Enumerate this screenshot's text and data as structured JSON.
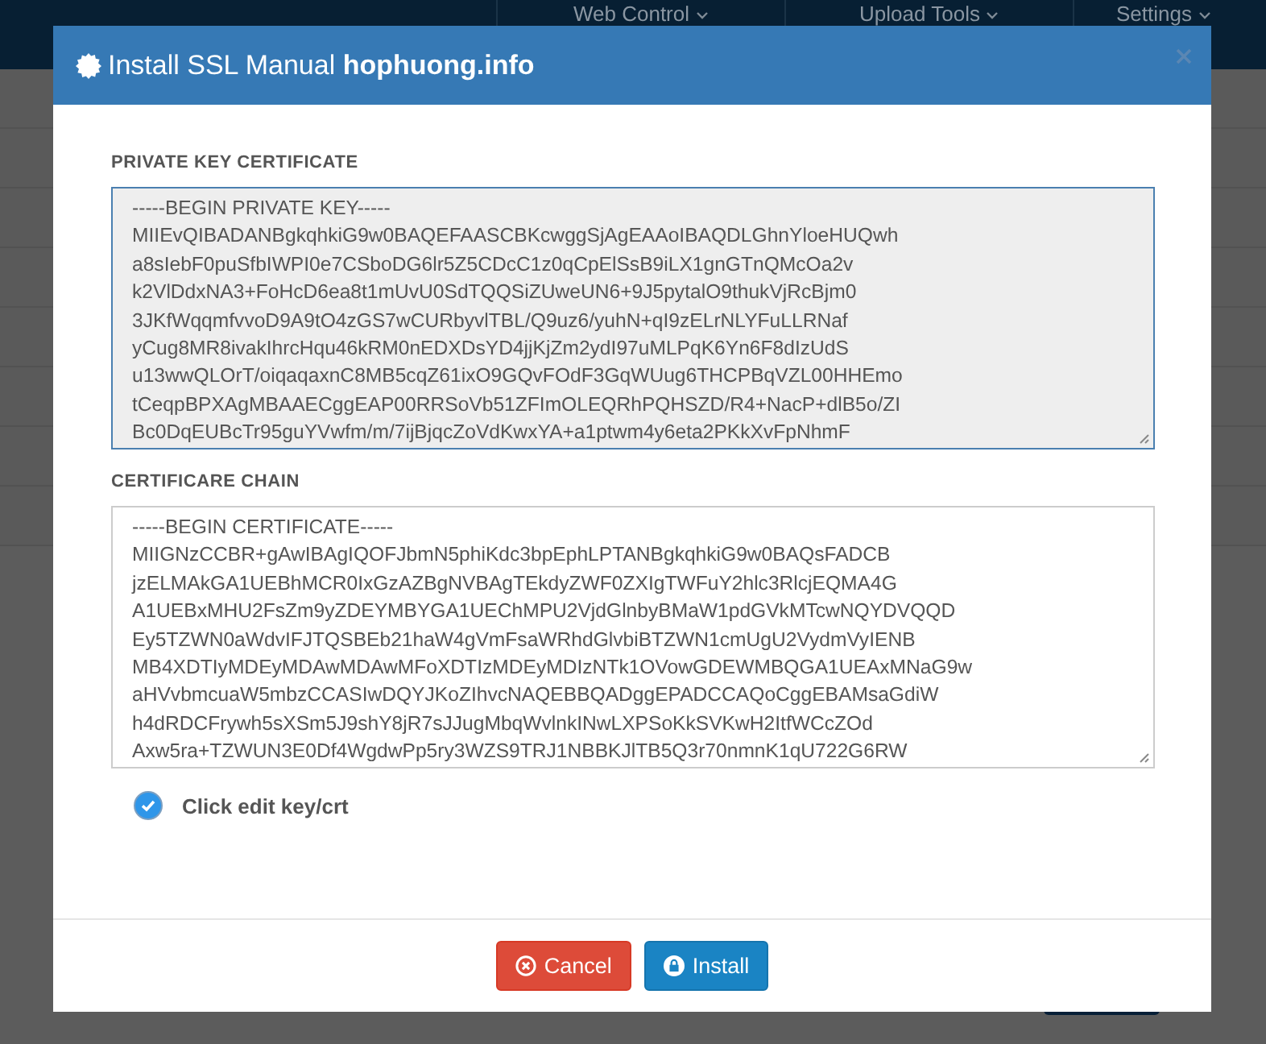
{
  "navbar": {
    "items": [
      {
        "label": "Web Control"
      },
      {
        "label": "Upload Tools"
      },
      {
        "label": "Settings"
      }
    ]
  },
  "modal": {
    "title": "Install SSL Manual **hophuong.info**",
    "private_key": {
      "label": "PRIVATE KEY CERTIFICATE",
      "disabled": true,
      "lines": [
        "-----BEGIN PRIVATE KEY-----",
        "MIIEvQIBADANBgkqhkiG9w0BAQEFAASCBKcwggSjAgEAAoIBAQDLGhnYloeHUQwh",
        "a8sIebF0puSfbIWPI0e7CSboDG6lr5Z5CDcC1z0qCpElSsB9iLX1gnGTnQMcOa2v",
        "k2VlDdxNA3+FoHcD6ea8t1mUvU0SdTQQSiZUweUN6+9J5pytalO9thukVjRcBjm0",
        "3JKfWqqmfvvoD9A9tO4zGS7wCURbyvlTBL/Q9uz6/yuhN+qI9zELrNLYFuLLRNaf",
        "yCug8MR8ivakIhrcHqu46kRM0nEDXDsYD4jjKjZm2ydI97uMLPqK6Yn6F8dIzUdS",
        "u13wwQLOrT/oiqaqaxnC8MB5cqZ61ixO9GQvFOdF3GqWUug6THCPBqVZL00HHEmo",
        "tCeqpBPXAgMBAAECggEAP00RRSoVb51ZFImOLEQRhPQHSZD/R4+NacP+dlB5o/ZI",
        "Bc0DqEUBcTr95guYVwfm/m/7ijBjqcZoVdKwxYA+a1ptwm4y6eta2PKkXvFpNhmF"
      ]
    },
    "certificate_chain": {
      "label": "CERTIFICARE CHAIN",
      "disabled": false,
      "lines": [
        "-----BEGIN CERTIFICATE-----",
        "MIIGNzCCBR+gAwIBAgIQOFJbmN5phiKdc3bpEphLPTANBgkqhkiG9w0BAQsFADCB",
        "jzELMAkGA1UEBhMCR0IxGzAZBgNVBAgTEkdyZWF0ZXIgTWFuY2hlc3RlcjEQMA4G",
        "A1UEBxMHU2FsZm9yZDEYMBYGA1UEChMPU2VjdGlnbyBMaW1pdGVkMTcwNQYDVQQD",
        "Ey5TZWN0aWdvIFJTQSBEb21haW4gVmFsaWRhdGlvbiBTZWN1cmUgU2VydmVyIENB",
        "MB4XDTIyMDEyMDAwMDAwMFoXDTIzMDEyMDIzNTk1OVowGDEWMBQGA1UEAxMNaG9w",
        "aHVvbmcuaW5mbzCCASIwDQYJKoZIhvcNAQEBBQADggEPADCCAQoCggEBAMsaGdiW",
        "h4dRDCFrywh5sXSm5J9shY8jR7sJJugMbqWvlnkINwLXPSoKkSVKwH2ItfWCcZOd",
        "Axw5ra+TZWUN3E0Df4WgdwPp5ry3WZS9TRJ1NBBKJlTB5Q3r70nmnK1qU722G6RW"
      ]
    },
    "edit_option": {
      "label": "Click edit key/crt",
      "checked": true
    },
    "buttons": [
      {
        "kind": "cancel",
        "label": "Cancel"
      },
      {
        "kind": "install",
        "label": "Install"
      }
    ]
  }
}
